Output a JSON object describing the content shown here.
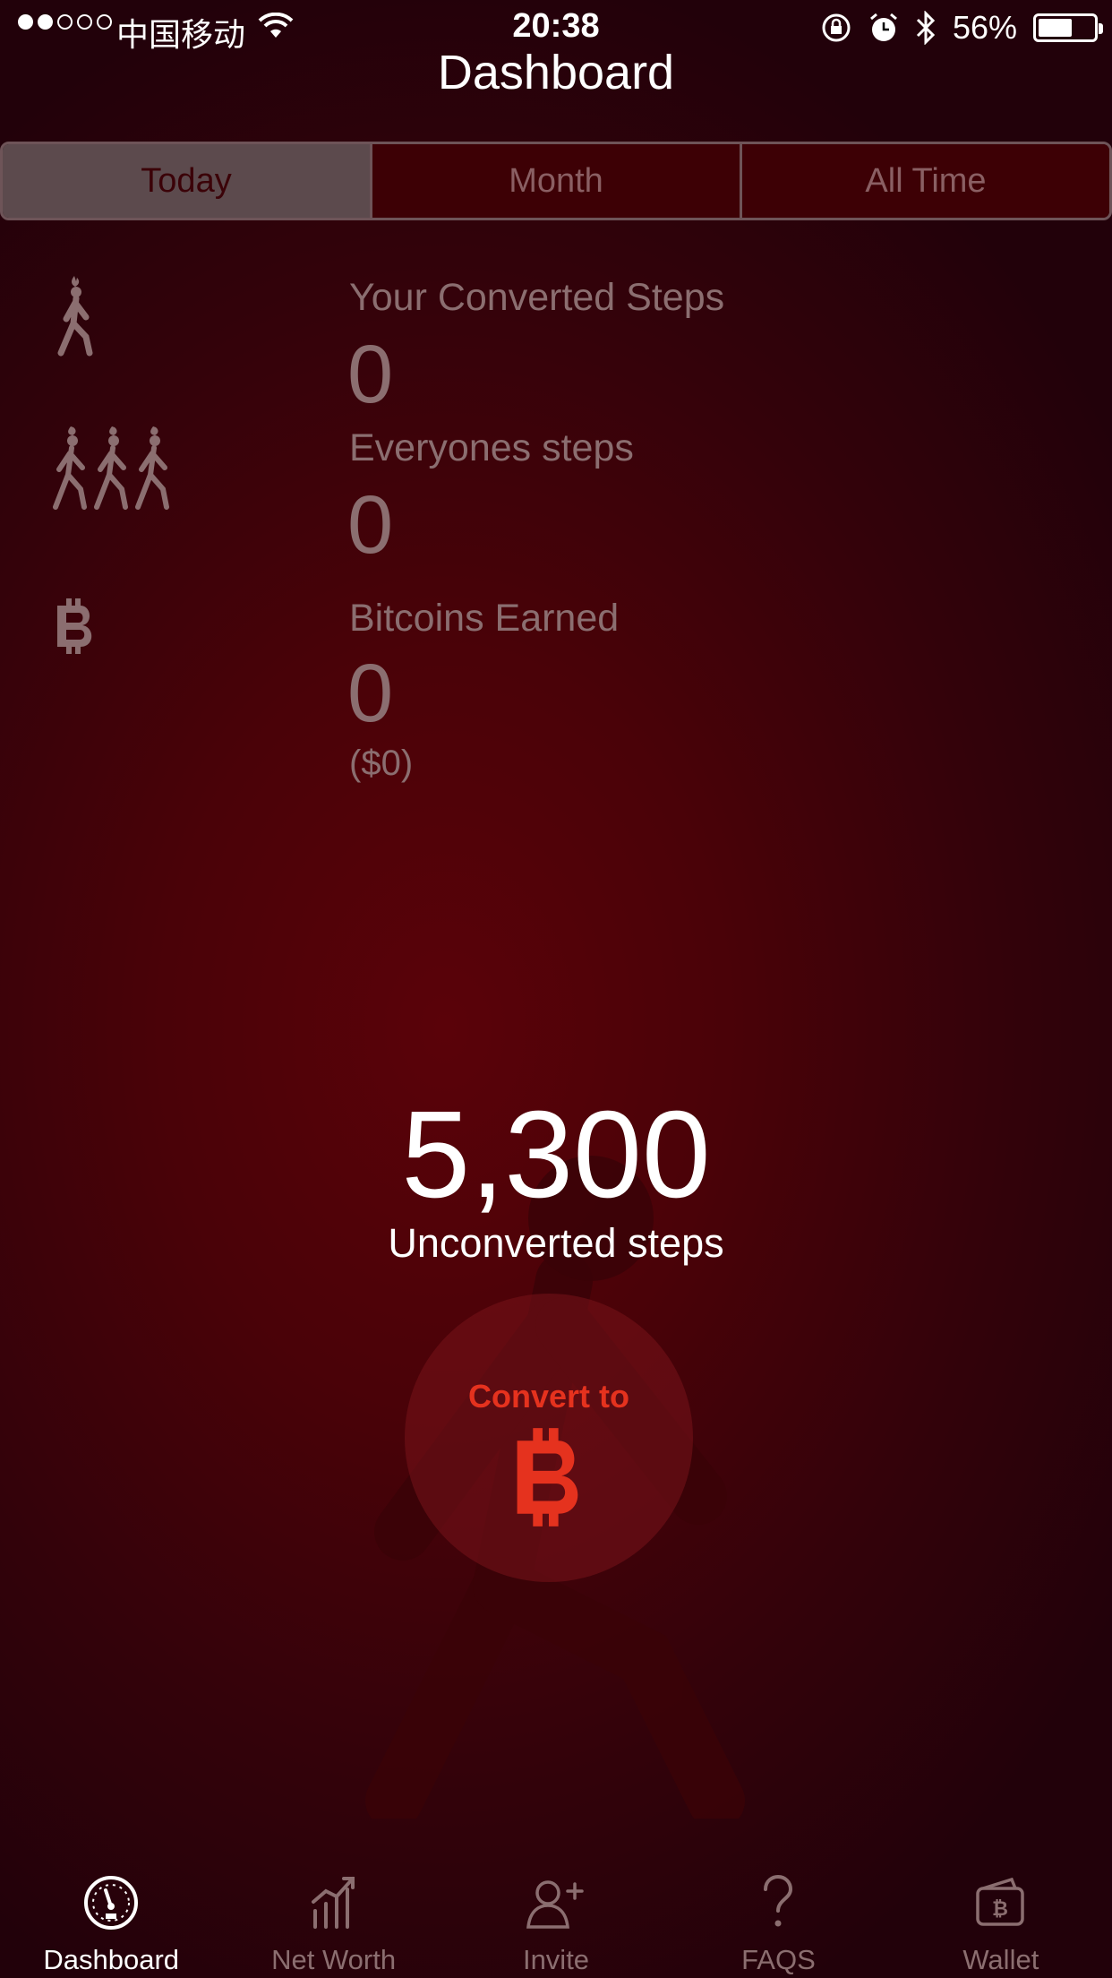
{
  "status_bar": {
    "carrier": "中国移动",
    "time": "20:38",
    "battery_percent": "56%",
    "battery_level": 0.56,
    "signal_bars_filled": 2,
    "signal_bars_total": 5
  },
  "header": {
    "title": "Dashboard"
  },
  "segments": [
    {
      "label": "Today",
      "active": true
    },
    {
      "label": "Month",
      "active": false
    },
    {
      "label": "All Time",
      "active": false
    }
  ],
  "stats": {
    "converted_steps": {
      "label": "Your Converted Steps",
      "value": "0",
      "icon": "walker-icon"
    },
    "everyone_steps": {
      "label": "Everyones steps",
      "value": "0",
      "icon": "group-walkers-icon"
    },
    "bitcoins_earned": {
      "label": "Bitcoins Earned",
      "value": "0",
      "usd": "($0)",
      "icon": "bitcoin-icon"
    }
  },
  "unconverted": {
    "count": "5,300",
    "label": "Unconverted steps"
  },
  "convert_button": {
    "label": "Convert to",
    "icon": "bitcoin-icon"
  },
  "tabs": [
    {
      "label": "Dashboard",
      "icon": "speedometer-icon",
      "active": true
    },
    {
      "label": "Net Worth",
      "icon": "chart-up-icon",
      "active": false
    },
    {
      "label": "Invite",
      "icon": "add-user-icon",
      "active": false
    },
    {
      "label": "FAQS",
      "icon": "question-icon",
      "active": false
    },
    {
      "label": "Wallet",
      "icon": "wallet-icon",
      "active": false
    }
  ],
  "colors": {
    "background": "#4a0208",
    "accent": "#e5321e",
    "muted_text": "#8b6e70",
    "segment_active": "#5c4a4d"
  }
}
